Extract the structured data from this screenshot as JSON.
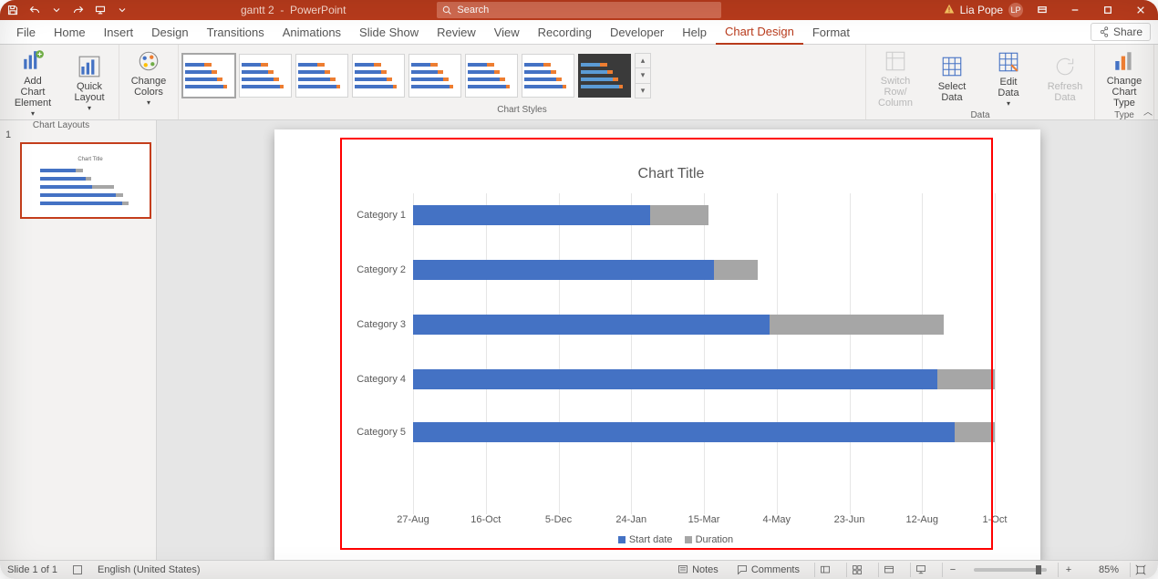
{
  "titlebar": {
    "doc": "gantt 2",
    "appname": "PowerPoint",
    "search_placeholder": "Search",
    "user": "Lia Pope",
    "initials": "LP"
  },
  "ribbon": {
    "tabs": [
      "File",
      "Home",
      "Insert",
      "Design",
      "Transitions",
      "Animations",
      "Slide Show",
      "Review",
      "View",
      "Recording",
      "Developer",
      "Help",
      "Chart Design",
      "Format"
    ],
    "active_tab": "Chart Design",
    "share": "Share",
    "groups": {
      "chart_layouts": {
        "label": "Chart Layouts",
        "add_element": "Add Chart\nElement",
        "quick_layout": "Quick\nLayout"
      },
      "change_colors": "Change\nColors",
      "chart_styles": "Chart Styles",
      "data": {
        "label": "Data",
        "switch": "Switch Row/\nColumn",
        "select": "Select\nData",
        "edit": "Edit\nData",
        "refresh": "Refresh\nData"
      },
      "type": {
        "label": "Type",
        "change_type": "Change\nChart Type"
      }
    }
  },
  "slidepanel": {
    "slide_number": "1"
  },
  "chart_data": {
    "type": "bar",
    "title": "Chart Title",
    "categories": [
      "Category 1",
      "Category 2",
      "Category 3",
      "Category 4",
      "Category 5"
    ],
    "series": [
      {
        "name": "Start date",
        "values": [
          163,
          207,
          245,
          365,
          405
        ],
        "color": "#4472c4"
      },
      {
        "name": "Duration",
        "values": [
          40,
          30,
          120,
          40,
          30
        ],
        "color": "#a6a6a6"
      }
    ],
    "xlabel": "",
    "ylabel": "",
    "x_ticks": [
      "27-Aug",
      "16-Oct",
      "5-Dec",
      "24-Jan",
      "15-Mar",
      "4-May",
      "23-Jun",
      "12-Aug",
      "1-Oct"
    ],
    "x_range_days": [
      0,
      400
    ],
    "legend": [
      "Start date",
      "Duration"
    ]
  },
  "statusbar": {
    "slide_info": "Slide 1 of 1",
    "language": "English (United States)",
    "notes": "Notes",
    "comments": "Comments",
    "zoom": "85%"
  }
}
